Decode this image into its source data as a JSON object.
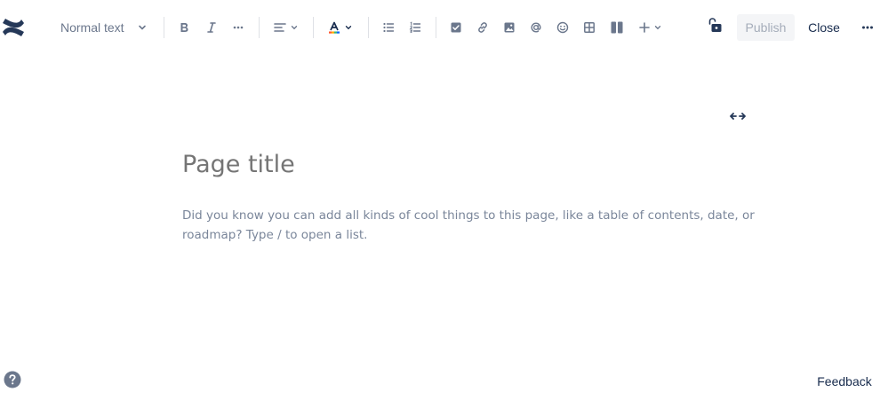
{
  "toolbar": {
    "text_style_label": "Normal text",
    "publish_label": "Publish",
    "close_label": "Close",
    "icons": [
      "text-style-chevron-icon",
      "bold-icon",
      "italic-icon",
      "more-formatting-icon",
      "alignment-icon",
      "text-color-icon",
      "bullet-list-icon",
      "numbered-list-icon",
      "action-item-icon",
      "link-icon",
      "image-icon",
      "mention-icon",
      "emoji-icon",
      "table-icon",
      "layouts-icon",
      "insert-icon",
      "restrictions-lock-icon",
      "more-actions-icon"
    ],
    "text_color_bar": "#172b4d"
  },
  "editor": {
    "title_placeholder": "Page title",
    "body_placeholder": "Did you know you can add all kinds of cool things to this page, like a table of contents, date, or roadmap? Type / to open a list."
  },
  "footer": {
    "feedback_label": "Feedback"
  },
  "colors": {
    "brand": "#253858",
    "muted_icon": "#6b778c",
    "placeholder": "#97a0af",
    "button_bg": "#f4f5f7"
  }
}
